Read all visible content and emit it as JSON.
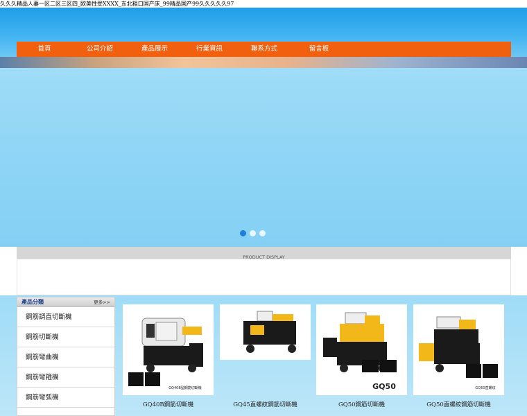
{
  "site_title": "久久久精品人妻一区二区三区四_欧美性受XXXX_东北粗口国产床_99精品国产99久久久久久97",
  "nav": {
    "items": [
      {
        "label": "首頁"
      },
      {
        "label": "公司介紹"
      },
      {
        "label": "產品展示"
      },
      {
        "label": "行業資訊"
      },
      {
        "label": "聯系方式"
      },
      {
        "label": "留言板"
      }
    ],
    "color": "#f0600e"
  },
  "carousel": {
    "dots": 3,
    "active_index": 0
  },
  "product_display": {
    "heading": "PRODUCT DISPLAY"
  },
  "categories": {
    "title": "產品分類",
    "more_label": "更多>>",
    "items": [
      {
        "label": "鋼筋調直切斷機"
      },
      {
        "label": "鋼筋切斷機"
      },
      {
        "label": "鋼筋彎曲機"
      },
      {
        "label": "鋼筋彎箍機"
      },
      {
        "label": "鋼筋彎弧機"
      }
    ]
  },
  "products": [
    {
      "caption": "GQ40B鋼筋切斷機",
      "badge": "GQ40B型鋼筋切斷機"
    },
    {
      "caption": "GQ45直螺紋鋼筋切斷機",
      "badge": ""
    },
    {
      "caption": "GQ50鋼筋切斷機",
      "badge": "GQ50"
    },
    {
      "caption": "GQ50直螺紋鋼筋切斷機",
      "badge": "GQ50直螺纹"
    }
  ],
  "colors": {
    "sky": "#8fd5f6",
    "machine_yellow": "#f2b81a",
    "machine_dark": "#1a1a1a"
  }
}
